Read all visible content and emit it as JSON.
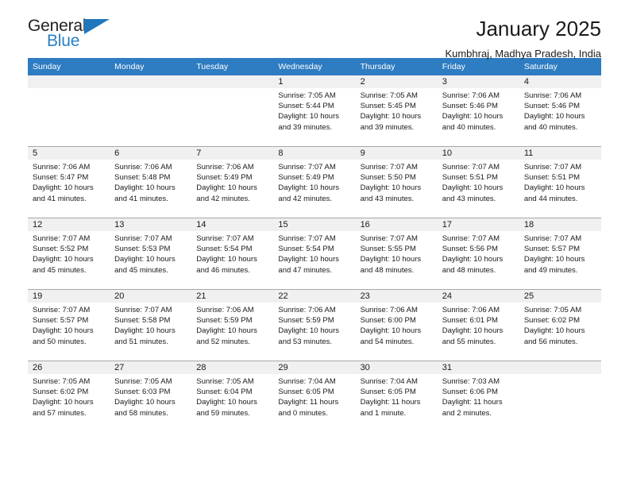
{
  "brand": {
    "name_part1": "General",
    "name_part2": "Blue"
  },
  "header": {
    "title": "January 2025",
    "subtitle": "Kumbhraj, Madhya Pradesh, India"
  },
  "calendar": {
    "weekday_headers": [
      "Sunday",
      "Monday",
      "Tuesday",
      "Wednesday",
      "Thursday",
      "Friday",
      "Saturday"
    ],
    "accent_color": "#2e7cc1",
    "daynum_band_color": "#f0f0f0",
    "weeks": [
      [
        {
          "day": "",
          "empty": true
        },
        {
          "day": "",
          "empty": true
        },
        {
          "day": "",
          "empty": true
        },
        {
          "day": "1",
          "sunrise": "Sunrise: 7:05 AM",
          "sunset": "Sunset: 5:44 PM",
          "daylight1": "Daylight: 10 hours",
          "daylight2": "and 39 minutes."
        },
        {
          "day": "2",
          "sunrise": "Sunrise: 7:05 AM",
          "sunset": "Sunset: 5:45 PM",
          "daylight1": "Daylight: 10 hours",
          "daylight2": "and 39 minutes."
        },
        {
          "day": "3",
          "sunrise": "Sunrise: 7:06 AM",
          "sunset": "Sunset: 5:46 PM",
          "daylight1": "Daylight: 10 hours",
          "daylight2": "and 40 minutes."
        },
        {
          "day": "4",
          "sunrise": "Sunrise: 7:06 AM",
          "sunset": "Sunset: 5:46 PM",
          "daylight1": "Daylight: 10 hours",
          "daylight2": "and 40 minutes."
        }
      ],
      [
        {
          "day": "5",
          "sunrise": "Sunrise: 7:06 AM",
          "sunset": "Sunset: 5:47 PM",
          "daylight1": "Daylight: 10 hours",
          "daylight2": "and 41 minutes."
        },
        {
          "day": "6",
          "sunrise": "Sunrise: 7:06 AM",
          "sunset": "Sunset: 5:48 PM",
          "daylight1": "Daylight: 10 hours",
          "daylight2": "and 41 minutes."
        },
        {
          "day": "7",
          "sunrise": "Sunrise: 7:06 AM",
          "sunset": "Sunset: 5:49 PM",
          "daylight1": "Daylight: 10 hours",
          "daylight2": "and 42 minutes."
        },
        {
          "day": "8",
          "sunrise": "Sunrise: 7:07 AM",
          "sunset": "Sunset: 5:49 PM",
          "daylight1": "Daylight: 10 hours",
          "daylight2": "and 42 minutes."
        },
        {
          "day": "9",
          "sunrise": "Sunrise: 7:07 AM",
          "sunset": "Sunset: 5:50 PM",
          "daylight1": "Daylight: 10 hours",
          "daylight2": "and 43 minutes."
        },
        {
          "day": "10",
          "sunrise": "Sunrise: 7:07 AM",
          "sunset": "Sunset: 5:51 PM",
          "daylight1": "Daylight: 10 hours",
          "daylight2": "and 43 minutes."
        },
        {
          "day": "11",
          "sunrise": "Sunrise: 7:07 AM",
          "sunset": "Sunset: 5:51 PM",
          "daylight1": "Daylight: 10 hours",
          "daylight2": "and 44 minutes."
        }
      ],
      [
        {
          "day": "12",
          "sunrise": "Sunrise: 7:07 AM",
          "sunset": "Sunset: 5:52 PM",
          "daylight1": "Daylight: 10 hours",
          "daylight2": "and 45 minutes."
        },
        {
          "day": "13",
          "sunrise": "Sunrise: 7:07 AM",
          "sunset": "Sunset: 5:53 PM",
          "daylight1": "Daylight: 10 hours",
          "daylight2": "and 45 minutes."
        },
        {
          "day": "14",
          "sunrise": "Sunrise: 7:07 AM",
          "sunset": "Sunset: 5:54 PM",
          "daylight1": "Daylight: 10 hours",
          "daylight2": "and 46 minutes."
        },
        {
          "day": "15",
          "sunrise": "Sunrise: 7:07 AM",
          "sunset": "Sunset: 5:54 PM",
          "daylight1": "Daylight: 10 hours",
          "daylight2": "and 47 minutes."
        },
        {
          "day": "16",
          "sunrise": "Sunrise: 7:07 AM",
          "sunset": "Sunset: 5:55 PM",
          "daylight1": "Daylight: 10 hours",
          "daylight2": "and 48 minutes."
        },
        {
          "day": "17",
          "sunrise": "Sunrise: 7:07 AM",
          "sunset": "Sunset: 5:56 PM",
          "daylight1": "Daylight: 10 hours",
          "daylight2": "and 48 minutes."
        },
        {
          "day": "18",
          "sunrise": "Sunrise: 7:07 AM",
          "sunset": "Sunset: 5:57 PM",
          "daylight1": "Daylight: 10 hours",
          "daylight2": "and 49 minutes."
        }
      ],
      [
        {
          "day": "19",
          "sunrise": "Sunrise: 7:07 AM",
          "sunset": "Sunset: 5:57 PM",
          "daylight1": "Daylight: 10 hours",
          "daylight2": "and 50 minutes."
        },
        {
          "day": "20",
          "sunrise": "Sunrise: 7:07 AM",
          "sunset": "Sunset: 5:58 PM",
          "daylight1": "Daylight: 10 hours",
          "daylight2": "and 51 minutes."
        },
        {
          "day": "21",
          "sunrise": "Sunrise: 7:06 AM",
          "sunset": "Sunset: 5:59 PM",
          "daylight1": "Daylight: 10 hours",
          "daylight2": "and 52 minutes."
        },
        {
          "day": "22",
          "sunrise": "Sunrise: 7:06 AM",
          "sunset": "Sunset: 5:59 PM",
          "daylight1": "Daylight: 10 hours",
          "daylight2": "and 53 minutes."
        },
        {
          "day": "23",
          "sunrise": "Sunrise: 7:06 AM",
          "sunset": "Sunset: 6:00 PM",
          "daylight1": "Daylight: 10 hours",
          "daylight2": "and 54 minutes."
        },
        {
          "day": "24",
          "sunrise": "Sunrise: 7:06 AM",
          "sunset": "Sunset: 6:01 PM",
          "daylight1": "Daylight: 10 hours",
          "daylight2": "and 55 minutes."
        },
        {
          "day": "25",
          "sunrise": "Sunrise: 7:05 AM",
          "sunset": "Sunset: 6:02 PM",
          "daylight1": "Daylight: 10 hours",
          "daylight2": "and 56 minutes."
        }
      ],
      [
        {
          "day": "26",
          "sunrise": "Sunrise: 7:05 AM",
          "sunset": "Sunset: 6:02 PM",
          "daylight1": "Daylight: 10 hours",
          "daylight2": "and 57 minutes."
        },
        {
          "day": "27",
          "sunrise": "Sunrise: 7:05 AM",
          "sunset": "Sunset: 6:03 PM",
          "daylight1": "Daylight: 10 hours",
          "daylight2": "and 58 minutes."
        },
        {
          "day": "28",
          "sunrise": "Sunrise: 7:05 AM",
          "sunset": "Sunset: 6:04 PM",
          "daylight1": "Daylight: 10 hours",
          "daylight2": "and 59 minutes."
        },
        {
          "day": "29",
          "sunrise": "Sunrise: 7:04 AM",
          "sunset": "Sunset: 6:05 PM",
          "daylight1": "Daylight: 11 hours",
          "daylight2": "and 0 minutes."
        },
        {
          "day": "30",
          "sunrise": "Sunrise: 7:04 AM",
          "sunset": "Sunset: 6:05 PM",
          "daylight1": "Daylight: 11 hours",
          "daylight2": "and 1 minute."
        },
        {
          "day": "31",
          "sunrise": "Sunrise: 7:03 AM",
          "sunset": "Sunset: 6:06 PM",
          "daylight1": "Daylight: 11 hours",
          "daylight2": "and 2 minutes."
        },
        {
          "day": "",
          "empty": true
        }
      ]
    ]
  }
}
